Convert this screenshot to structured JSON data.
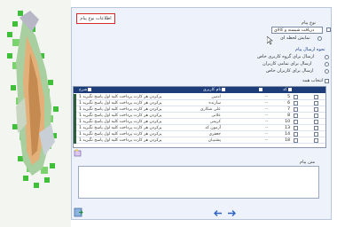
{
  "header": {
    "title_label": "اطلاعات نوع پیام"
  },
  "form": {
    "message_type_label": "نوع پیام",
    "message_type_value": "دریافت شیسته و کالای",
    "show_in_form_label": "نمایش لحظه ای",
    "send_type_label": "نحوه ارسال پیام",
    "option_group": "ارسال برای گروه کاربری خاص",
    "option_all": "ارسال برای تمامی کاربران",
    "option_specific": "ارسال برای کاربران خاص",
    "select_all_label": "انتخاب همه"
  },
  "table": {
    "headers": [
      "شرح",
      "نام کاربری",
      "",
      "کد"
    ],
    "rows": [
      {
        "desc": "پرکردن هر کارت پرداخت کلیه اول پاسخ نگیرید 1",
        "name": "ادمین",
        "dash": "--",
        "code": "5"
      },
      {
        "desc": "پرکردن هر کارت پرداخت کلیه اول پاسخ نگیرید 1",
        "name": "سازنده",
        "dash": "--",
        "code": "6"
      },
      {
        "desc": "پرکردن هر کارت پرداخت کلیه اول پاسخ نگیرید 1",
        "name": "علی شکاری",
        "dash": "--",
        "code": "7"
      },
      {
        "desc": "پرکردن هر کارت پرداخت کلیه اول پاسخ نگیرید 1",
        "name": "علانی",
        "dash": "--",
        "code": "8"
      },
      {
        "desc": "پرکردن هر کارت پرداخت کلیه اول پاسخ نگیرید 1",
        "name": "کریمی",
        "dash": "--",
        "code": "10"
      },
      {
        "desc": "پرکردن هر کارت پرداخت کلیه اول پاسخ نگیرید 1",
        "name": "آزمون کد",
        "dash": "--",
        "code": "13"
      },
      {
        "desc": "پرکردن هر کارت پرداخت کلیه اول پاسخ نگیرید 1",
        "name": "جعفری",
        "dash": "--",
        "code": "14"
      },
      {
        "desc": "پرکردن هر کارت پرداخت کلیه اول پاسخ نگیرید 1",
        "name": "پشتیبان",
        "dash": "--",
        "code": "18"
      }
    ]
  },
  "message": {
    "label": "متن پیام",
    "value": ""
  },
  "colors": {
    "accent": "#1c3c7a",
    "title_border": "#d42a2a",
    "row_indicator": "#2d5e3a"
  }
}
